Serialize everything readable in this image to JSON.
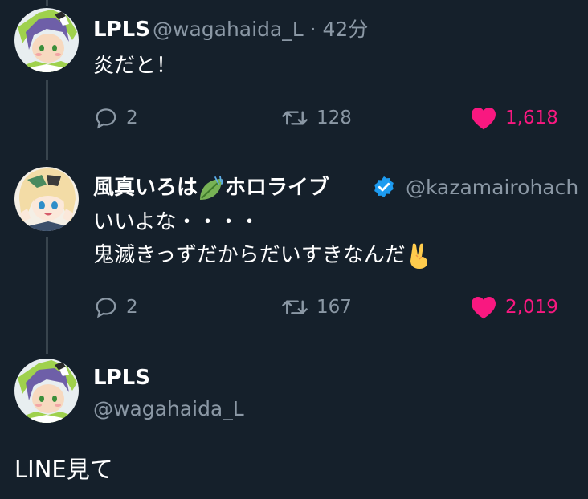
{
  "tweets": [
    {
      "display_name": "LPLS",
      "handle_time": "@wagahaida_L · 42分",
      "text": "炎だと！",
      "replies": "2",
      "retweets": "128",
      "likes": "1,618"
    },
    {
      "display_name_prefix": "風真いろは",
      "display_name_suffix": "ホロライブ",
      "handle": "@kazamairohach",
      "line1": "いいよな・・・・",
      "line2": "鬼滅きっずだからだいすきなんだ",
      "replies": "2",
      "retweets": "167",
      "likes": "2,019"
    }
  ],
  "focused": {
    "display_name": "LPLS",
    "handle": "@wagahaida_L",
    "text": "LINE見て"
  },
  "colors": {
    "background": "#15202b",
    "text_secondary": "#8b98a5",
    "like": "#f91880",
    "verified": "#1d9bf0",
    "thread_line": "#38444d"
  },
  "icons": [
    "reply-icon",
    "retweet-icon",
    "heart-icon",
    "verified-badge-icon",
    "leaf-emoji-icon",
    "victory-hand-emoji-icon"
  ]
}
